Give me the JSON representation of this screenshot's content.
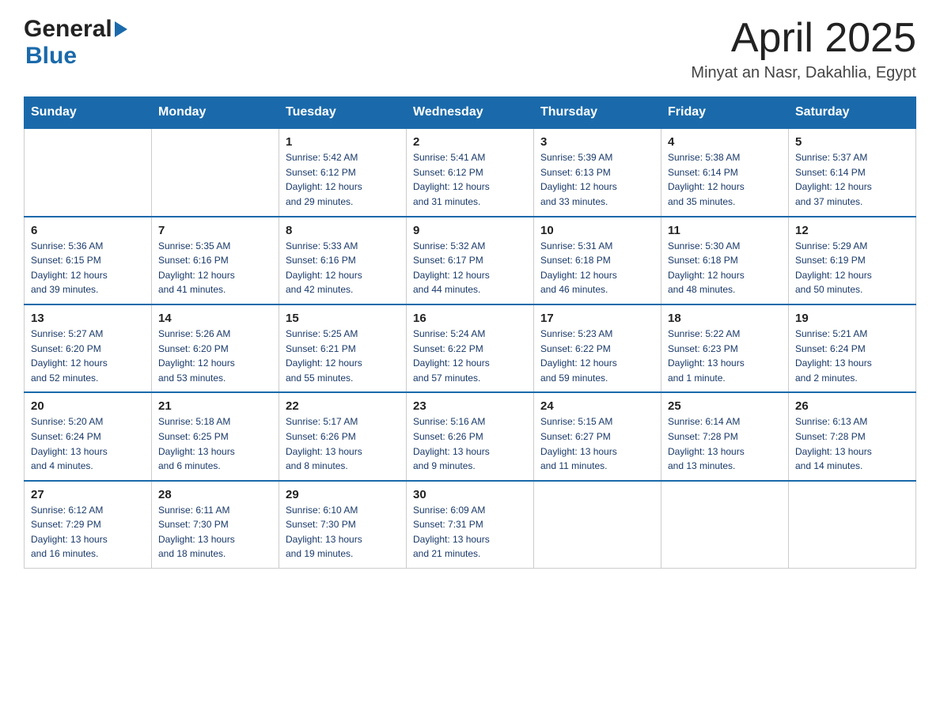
{
  "header": {
    "logo_general": "General",
    "logo_blue": "Blue",
    "title": "April 2025",
    "subtitle": "Minyat an Nasr, Dakahlia, Egypt"
  },
  "weekdays": [
    "Sunday",
    "Monday",
    "Tuesday",
    "Wednesday",
    "Thursday",
    "Friday",
    "Saturday"
  ],
  "weeks": [
    [
      {
        "day": "",
        "info": ""
      },
      {
        "day": "",
        "info": ""
      },
      {
        "day": "1",
        "info": "Sunrise: 5:42 AM\nSunset: 6:12 PM\nDaylight: 12 hours\nand 29 minutes."
      },
      {
        "day": "2",
        "info": "Sunrise: 5:41 AM\nSunset: 6:12 PM\nDaylight: 12 hours\nand 31 minutes."
      },
      {
        "day": "3",
        "info": "Sunrise: 5:39 AM\nSunset: 6:13 PM\nDaylight: 12 hours\nand 33 minutes."
      },
      {
        "day": "4",
        "info": "Sunrise: 5:38 AM\nSunset: 6:14 PM\nDaylight: 12 hours\nand 35 minutes."
      },
      {
        "day": "5",
        "info": "Sunrise: 5:37 AM\nSunset: 6:14 PM\nDaylight: 12 hours\nand 37 minutes."
      }
    ],
    [
      {
        "day": "6",
        "info": "Sunrise: 5:36 AM\nSunset: 6:15 PM\nDaylight: 12 hours\nand 39 minutes."
      },
      {
        "day": "7",
        "info": "Sunrise: 5:35 AM\nSunset: 6:16 PM\nDaylight: 12 hours\nand 41 minutes."
      },
      {
        "day": "8",
        "info": "Sunrise: 5:33 AM\nSunset: 6:16 PM\nDaylight: 12 hours\nand 42 minutes."
      },
      {
        "day": "9",
        "info": "Sunrise: 5:32 AM\nSunset: 6:17 PM\nDaylight: 12 hours\nand 44 minutes."
      },
      {
        "day": "10",
        "info": "Sunrise: 5:31 AM\nSunset: 6:18 PM\nDaylight: 12 hours\nand 46 minutes."
      },
      {
        "day": "11",
        "info": "Sunrise: 5:30 AM\nSunset: 6:18 PM\nDaylight: 12 hours\nand 48 minutes."
      },
      {
        "day": "12",
        "info": "Sunrise: 5:29 AM\nSunset: 6:19 PM\nDaylight: 12 hours\nand 50 minutes."
      }
    ],
    [
      {
        "day": "13",
        "info": "Sunrise: 5:27 AM\nSunset: 6:20 PM\nDaylight: 12 hours\nand 52 minutes."
      },
      {
        "day": "14",
        "info": "Sunrise: 5:26 AM\nSunset: 6:20 PM\nDaylight: 12 hours\nand 53 minutes."
      },
      {
        "day": "15",
        "info": "Sunrise: 5:25 AM\nSunset: 6:21 PM\nDaylight: 12 hours\nand 55 minutes."
      },
      {
        "day": "16",
        "info": "Sunrise: 5:24 AM\nSunset: 6:22 PM\nDaylight: 12 hours\nand 57 minutes."
      },
      {
        "day": "17",
        "info": "Sunrise: 5:23 AM\nSunset: 6:22 PM\nDaylight: 12 hours\nand 59 minutes."
      },
      {
        "day": "18",
        "info": "Sunrise: 5:22 AM\nSunset: 6:23 PM\nDaylight: 13 hours\nand 1 minute."
      },
      {
        "day": "19",
        "info": "Sunrise: 5:21 AM\nSunset: 6:24 PM\nDaylight: 13 hours\nand 2 minutes."
      }
    ],
    [
      {
        "day": "20",
        "info": "Sunrise: 5:20 AM\nSunset: 6:24 PM\nDaylight: 13 hours\nand 4 minutes."
      },
      {
        "day": "21",
        "info": "Sunrise: 5:18 AM\nSunset: 6:25 PM\nDaylight: 13 hours\nand 6 minutes."
      },
      {
        "day": "22",
        "info": "Sunrise: 5:17 AM\nSunset: 6:26 PM\nDaylight: 13 hours\nand 8 minutes."
      },
      {
        "day": "23",
        "info": "Sunrise: 5:16 AM\nSunset: 6:26 PM\nDaylight: 13 hours\nand 9 minutes."
      },
      {
        "day": "24",
        "info": "Sunrise: 5:15 AM\nSunset: 6:27 PM\nDaylight: 13 hours\nand 11 minutes."
      },
      {
        "day": "25",
        "info": "Sunrise: 6:14 AM\nSunset: 7:28 PM\nDaylight: 13 hours\nand 13 minutes."
      },
      {
        "day": "26",
        "info": "Sunrise: 6:13 AM\nSunset: 7:28 PM\nDaylight: 13 hours\nand 14 minutes."
      }
    ],
    [
      {
        "day": "27",
        "info": "Sunrise: 6:12 AM\nSunset: 7:29 PM\nDaylight: 13 hours\nand 16 minutes."
      },
      {
        "day": "28",
        "info": "Sunrise: 6:11 AM\nSunset: 7:30 PM\nDaylight: 13 hours\nand 18 minutes."
      },
      {
        "day": "29",
        "info": "Sunrise: 6:10 AM\nSunset: 7:30 PM\nDaylight: 13 hours\nand 19 minutes."
      },
      {
        "day": "30",
        "info": "Sunrise: 6:09 AM\nSunset: 7:31 PM\nDaylight: 13 hours\nand 21 minutes."
      },
      {
        "day": "",
        "info": ""
      },
      {
        "day": "",
        "info": ""
      },
      {
        "day": "",
        "info": ""
      }
    ]
  ]
}
